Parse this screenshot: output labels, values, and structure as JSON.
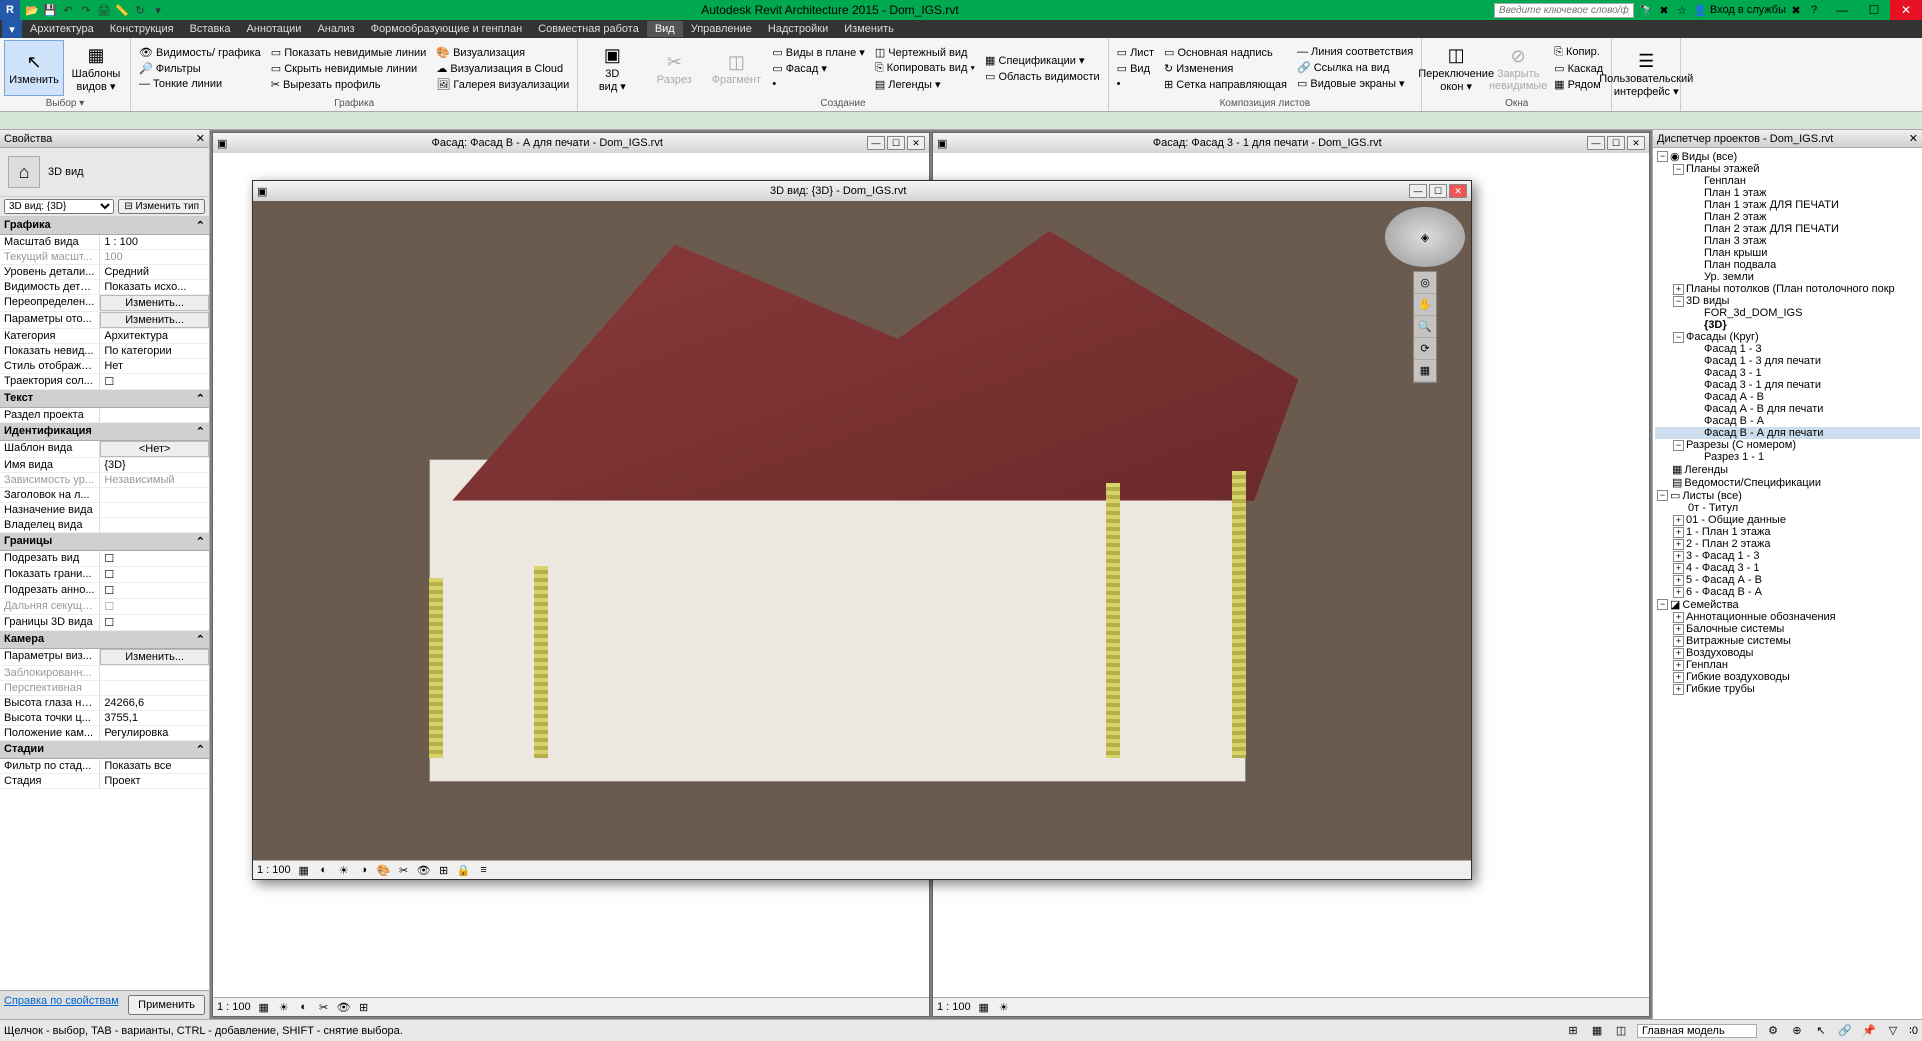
{
  "app": {
    "title": "Autodesk Revit Architecture 2015 -     Dom_IGS.rvt",
    "search_placeholder": "Введите ключевое слово/фразу",
    "login": "Вход в службы"
  },
  "menu": [
    "Архитектура",
    "Конструкция",
    "Вставка",
    "Аннотации",
    "Анализ",
    "Формообразующие и генплан",
    "Совместная работа",
    "Вид",
    "Управление",
    "Надстройки",
    "Изменить"
  ],
  "menu_active": 7,
  "ribbon": {
    "groups": [
      {
        "label": "Выбор ▾",
        "big": [
          {
            "icon": "↖",
            "text": "Изменить",
            "sel": true
          },
          {
            "icon": "▦",
            "text": "Шаблоны\nвидов ▾"
          }
        ]
      },
      {
        "label": "Графика",
        "small": [
          [
            "👁 Видимость/ графика",
            "🔎 Фильтры",
            "— Тонкие линии"
          ],
          [
            "▭ Показать невидимые линии",
            "▭ Скрыть невидимые линии",
            "✂ Вырезать профиль"
          ],
          [
            "🎨 Визуализация",
            "☁ Визуализация в Cloud",
            "🖼 Галерея визуализации"
          ]
        ]
      },
      {
        "label": "Создание",
        "big": [
          {
            "icon": "▣",
            "text": "3D\nвид ▾"
          },
          {
            "icon": "✂",
            "text": "Разрез",
            "disabled": true
          },
          {
            "icon": "◫",
            "text": "Фрагмент",
            "disabled": true
          }
        ],
        "small": [
          [
            "▭ Виды в плане ▾",
            "▭ Фасад ▾",
            "•"
          ],
          [
            "◫ Чертежный вид",
            "⎘ Копировать вид ▾",
            "▤ Легенды ▾"
          ],
          [
            "▦ Спецификации ▾",
            "▭ Область видимости"
          ]
        ]
      },
      {
        "label": "Композиция листов",
        "small": [
          [
            "▭ Лист",
            "▭ Вид",
            "•"
          ],
          [
            "▭ Основная надпись",
            "↻ Изменения",
            "⊞ Сетка направляющая"
          ],
          [
            "— Линия соответствия",
            "🔗 Ссылка на вид",
            "▭ Видовые экраны ▾"
          ]
        ]
      },
      {
        "label": "Окна",
        "big": [
          {
            "icon": "◫",
            "text": "Переключение\nокон ▾"
          },
          {
            "icon": "⊘",
            "text": "Закрыть\nневидимые",
            "disabled": true
          }
        ],
        "small": [
          [
            "⎘ Копир.",
            "▭ Каскад",
            "▦ Рядом"
          ]
        ]
      },
      {
        "label": "",
        "big": [
          {
            "icon": "☰",
            "text": "Пользовательский\nинтерфейс ▾"
          }
        ]
      }
    ]
  },
  "properties": {
    "title": "Свойства",
    "type": "3D вид",
    "selector": "3D вид: {3D}",
    "change_type": "⊟ Изменить тип",
    "groups": [
      {
        "hdr": "Графика",
        "rows": [
          {
            "k": "Масштаб вида",
            "v": "1 : 100"
          },
          {
            "k": "Текущий масшт...",
            "v": "100",
            "disabled": true
          },
          {
            "k": "Уровень детали...",
            "v": "Средний"
          },
          {
            "k": "Видимость дета...",
            "v": "Показать исхо..."
          },
          {
            "k": "Переопределен...",
            "v": "Изменить...",
            "btn": true
          },
          {
            "k": "Параметры ото...",
            "v": "Изменить...",
            "btn": true
          },
          {
            "k": "Категория",
            "v": "Архитектура"
          },
          {
            "k": "Показать невид...",
            "v": "По категории"
          },
          {
            "k": "Стиль отображе...",
            "v": "Нет"
          },
          {
            "k": "Траектория сол...",
            "v": "",
            "chk": true
          }
        ]
      },
      {
        "hdr": "Текст",
        "rows": [
          {
            "k": "Раздел проекта",
            "v": ""
          }
        ]
      },
      {
        "hdr": "Идентификация",
        "rows": [
          {
            "k": "Шаблон вида",
            "v": "<Нет>",
            "btn": true
          },
          {
            "k": "Имя вида",
            "v": "{3D}"
          },
          {
            "k": "Зависимость ур...",
            "v": "Независимый",
            "disabled": true
          },
          {
            "k": "Заголовок на л...",
            "v": ""
          },
          {
            "k": "Назначение вида",
            "v": ""
          },
          {
            "k": "Владелец вида",
            "v": ""
          }
        ]
      },
      {
        "hdr": "Границы",
        "rows": [
          {
            "k": "Подрезать вид",
            "v": "",
            "chk": true
          },
          {
            "k": "Показать грани...",
            "v": "",
            "chk": true
          },
          {
            "k": "Подрезать анно...",
            "v": "",
            "chk": true
          },
          {
            "k": "Дальняя секуща...",
            "v": "",
            "chk": true,
            "disabled": true
          },
          {
            "k": "Границы 3D вида",
            "v": "",
            "chk": true
          }
        ]
      },
      {
        "hdr": "Камера",
        "rows": [
          {
            "k": "Параметры виз...",
            "v": "Изменить...",
            "btn": true
          },
          {
            "k": "Заблокированн...",
            "v": "",
            "disabled": true
          },
          {
            "k": "Перспективная",
            "v": "",
            "disabled": true
          },
          {
            "k": "Высота глаза на...",
            "v": "24266,6"
          },
          {
            "k": "Высота точки ц...",
            "v": "3755,1"
          },
          {
            "k": "Положение кам...",
            "v": "Регулировка"
          }
        ]
      },
      {
        "hdr": "Стадии",
        "rows": [
          {
            "k": "Фильтр по стад...",
            "v": "Показать все"
          },
          {
            "k": "Стадия",
            "v": "Проект"
          }
        ]
      }
    ],
    "help": "Справка по свойствам",
    "apply": "Применить"
  },
  "windows": {
    "bg1": "Фасад: Фасад В - А для печати - Dom_IGS.rvt",
    "bg2": "Фасад: Фасад 3 - 1 для печати - Dom_IGS.rvt",
    "float": "3D вид: {3D} - Dom_IGS.rvt",
    "scale": "1 : 100"
  },
  "browser": {
    "title": "Диспетчер проектов - Dom_IGS.rvt",
    "tree": [
      {
        "l": 0,
        "t": "Виды (все)",
        "e": "-",
        "ico": "◉"
      },
      {
        "l": 1,
        "t": "Планы этажей",
        "e": "-"
      },
      {
        "l": 2,
        "t": "Генплан"
      },
      {
        "l": 2,
        "t": "План 1 этаж"
      },
      {
        "l": 2,
        "t": "План 1 этаж ДЛЯ ПЕЧАТИ"
      },
      {
        "l": 2,
        "t": "План 2 этаж"
      },
      {
        "l": 2,
        "t": "План 2 этаж ДЛЯ ПЕЧАТИ"
      },
      {
        "l": 2,
        "t": "План 3 этаж"
      },
      {
        "l": 2,
        "t": "План крыши"
      },
      {
        "l": 2,
        "t": "План подвала"
      },
      {
        "l": 2,
        "t": "Ур. земли"
      },
      {
        "l": 1,
        "t": "Планы потолков (План потолочного покр",
        "e": "+"
      },
      {
        "l": 1,
        "t": "3D виды",
        "e": "-"
      },
      {
        "l": 2,
        "t": "FOR_3d_DOM_IGS"
      },
      {
        "l": 2,
        "t": "{3D}",
        "bold": true
      },
      {
        "l": 1,
        "t": "Фасады (Круг)",
        "e": "-"
      },
      {
        "l": 2,
        "t": "Фасад 1 - 3"
      },
      {
        "l": 2,
        "t": "Фасад 1 - 3 для печати"
      },
      {
        "l": 2,
        "t": "Фасад 3 - 1"
      },
      {
        "l": 2,
        "t": "Фасад 3 - 1 для печати"
      },
      {
        "l": 2,
        "t": "Фасад А - В"
      },
      {
        "l": 2,
        "t": "Фасад А - В для печати"
      },
      {
        "l": 2,
        "t": "Фасад В - А"
      },
      {
        "l": 2,
        "t": "Фасад В - А для печати",
        "sel": true
      },
      {
        "l": 1,
        "t": "Разрезы (С номером)",
        "e": "-"
      },
      {
        "l": 2,
        "t": "Разрез 1 - 1"
      },
      {
        "l": 0,
        "t": "Легенды",
        "ico": "▦"
      },
      {
        "l": 0,
        "t": "Ведомости/Спецификации",
        "ico": "▤"
      },
      {
        "l": 0,
        "t": "Листы (все)",
        "e": "-",
        "ico": "▭"
      },
      {
        "l": 1,
        "t": "0т - Титул"
      },
      {
        "l": 1,
        "t": "01 - Общие данные",
        "e": "+"
      },
      {
        "l": 1,
        "t": "1 - План 1 этажа",
        "e": "+"
      },
      {
        "l": 1,
        "t": "2 - План 2 этажа",
        "e": "+"
      },
      {
        "l": 1,
        "t": "3 - Фасад 1 - 3",
        "e": "+"
      },
      {
        "l": 1,
        "t": "4 - Фасад 3 - 1",
        "e": "+"
      },
      {
        "l": 1,
        "t": "5 - Фасад А - В",
        "e": "+"
      },
      {
        "l": 1,
        "t": "6 - Фасад В - А",
        "e": "+"
      },
      {
        "l": 0,
        "t": "Семейства",
        "e": "-",
        "ico": "◪"
      },
      {
        "l": 1,
        "t": "Аннотационные обозначения",
        "e": "+"
      },
      {
        "l": 1,
        "t": "Балочные системы",
        "e": "+"
      },
      {
        "l": 1,
        "t": "Витражные системы",
        "e": "+"
      },
      {
        "l": 1,
        "t": "Воздуховоды",
        "e": "+"
      },
      {
        "l": 1,
        "t": "Генплан",
        "e": "+"
      },
      {
        "l": 1,
        "t": "Гибкие воздуховоды",
        "e": "+"
      },
      {
        "l": 1,
        "t": "Гибкие трубы",
        "e": "+"
      }
    ]
  },
  "status": {
    "hint": "Щелчок - выбор, TAB - варианты, CTRL - добавление, SHIFT - снятие выбора.",
    "model": "Главная модель"
  }
}
